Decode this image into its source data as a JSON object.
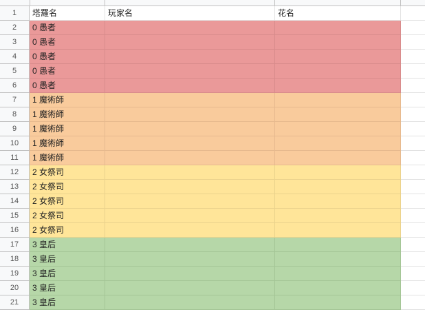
{
  "header_row": {
    "row_number": "1",
    "col_a": "塔羅名",
    "col_b": "玩家名",
    "col_c": "花名",
    "col_d": ""
  },
  "row_colors": {
    "red": "#ea9999",
    "orange": "#f9cb9c",
    "yellow": "#ffe599",
    "green": "#b6d7a8"
  },
  "rows": [
    {
      "num": "2",
      "a": "0 愚者",
      "b": "",
      "c": "",
      "color": "red"
    },
    {
      "num": "3",
      "a": "0 愚者",
      "b": "",
      "c": "",
      "color": "red"
    },
    {
      "num": "4",
      "a": "0 愚者",
      "b": "",
      "c": "",
      "color": "red"
    },
    {
      "num": "5",
      "a": "0 愚者",
      "b": "",
      "c": "",
      "color": "red"
    },
    {
      "num": "6",
      "a": "0 愚者",
      "b": "",
      "c": "",
      "color": "red"
    },
    {
      "num": "7",
      "a": "1 魔術師",
      "b": "",
      "c": "",
      "color": "orange"
    },
    {
      "num": "8",
      "a": "1 魔術師",
      "b": "",
      "c": "",
      "color": "orange"
    },
    {
      "num": "9",
      "a": "1 魔術師",
      "b": "",
      "c": "",
      "color": "orange"
    },
    {
      "num": "10",
      "a": "1 魔術師",
      "b": "",
      "c": "",
      "color": "orange"
    },
    {
      "num": "11",
      "a": "1 魔術師",
      "b": "",
      "c": "",
      "color": "orange"
    },
    {
      "num": "12",
      "a": "2 女祭司",
      "b": "",
      "c": "",
      "color": "yellow"
    },
    {
      "num": "13",
      "a": "2 女祭司",
      "b": "",
      "c": "",
      "color": "yellow"
    },
    {
      "num": "14",
      "a": "2 女祭司",
      "b": "",
      "c": "",
      "color": "yellow"
    },
    {
      "num": "15",
      "a": "2 女祭司",
      "b": "",
      "c": "",
      "color": "yellow"
    },
    {
      "num": "16",
      "a": "2 女祭司",
      "b": "",
      "c": "",
      "color": "yellow"
    },
    {
      "num": "17",
      "a": "3  皇后",
      "b": "",
      "c": "",
      "color": "green"
    },
    {
      "num": "18",
      "a": "3  皇后",
      "b": "",
      "c": "",
      "color": "green"
    },
    {
      "num": "19",
      "a": "3  皇后",
      "b": "",
      "c": "",
      "color": "green"
    },
    {
      "num": "20",
      "a": "3  皇后",
      "b": "",
      "c": "",
      "color": "green"
    },
    {
      "num": "21",
      "a": "3  皇后",
      "b": "",
      "c": "",
      "color": "green"
    }
  ]
}
